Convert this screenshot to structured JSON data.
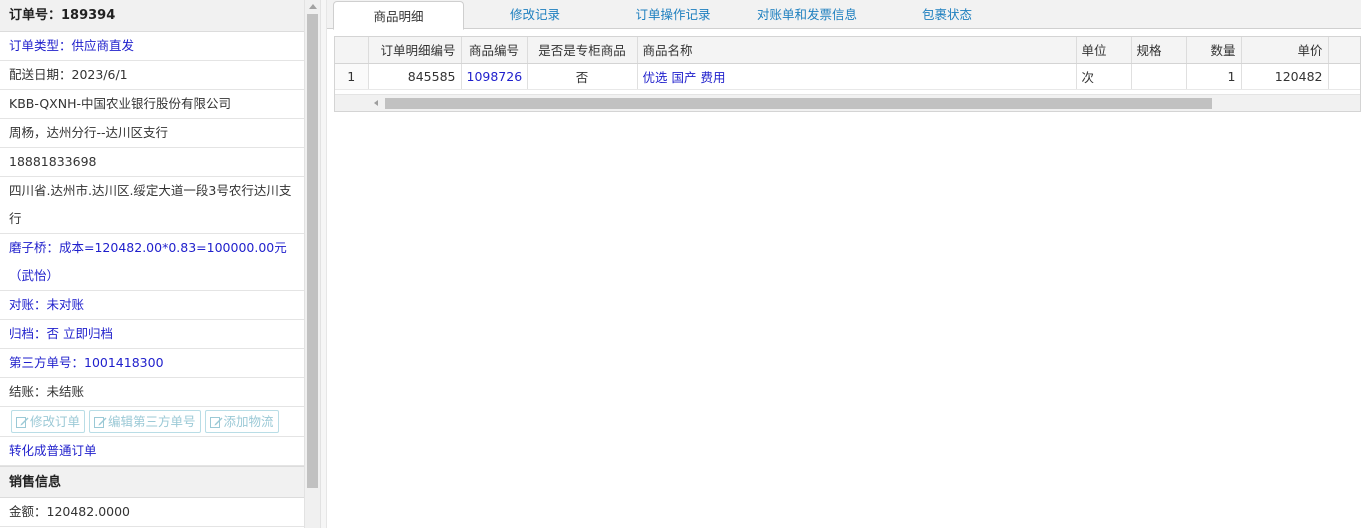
{
  "order": {
    "header": "订单号：189394",
    "type": "订单类型：供应商直发",
    "delivery_date": "配送日期：2023/6/1",
    "company": "KBB-QXNH-中国农业银行股份有限公司",
    "contact": "周杨，达州分行--达川区支行",
    "phone": "18881833698",
    "address": "四川省.达州市.达川区.绥定大道一段3号农行达川支行",
    "cost_note": "磨子桥：成本=120482.00*0.83=100000.00元（武怡）",
    "reconcile": "对账：未对账",
    "archive": "归档：否 立即归档",
    "third_party_no": "第三方单号：1001418300",
    "settlement": "结账：未结账",
    "buttons": {
      "edit_order": "修改订单",
      "edit_third_party": "编辑第三方单号",
      "add_logistics": "添加物流"
    },
    "convert": "转化成普通订单"
  },
  "sales": {
    "header": "销售信息",
    "amount": "金额：120482.0000"
  },
  "tabs": [
    "商品明细",
    "修改记录",
    "订单操作记录",
    "对账单和发票信息",
    "包裹状态"
  ],
  "grid": {
    "columns": [
      "订单明细编号",
      "商品编号",
      "是否是专柜商品",
      "商品名称",
      "单位",
      "规格",
      "数量",
      "单价"
    ],
    "rows": [
      {
        "index": "1",
        "detail_id": "845585",
        "product_id": "1098726",
        "counter": "否",
        "name": "优选 国产 费用",
        "unit": "次",
        "spec": "",
        "qty": "1",
        "price": "120482"
      }
    ]
  },
  "colors": {
    "link": "#1f1fcc",
    "tab": "#1d7fbf",
    "disabled_btn": "#9bc9d6"
  }
}
